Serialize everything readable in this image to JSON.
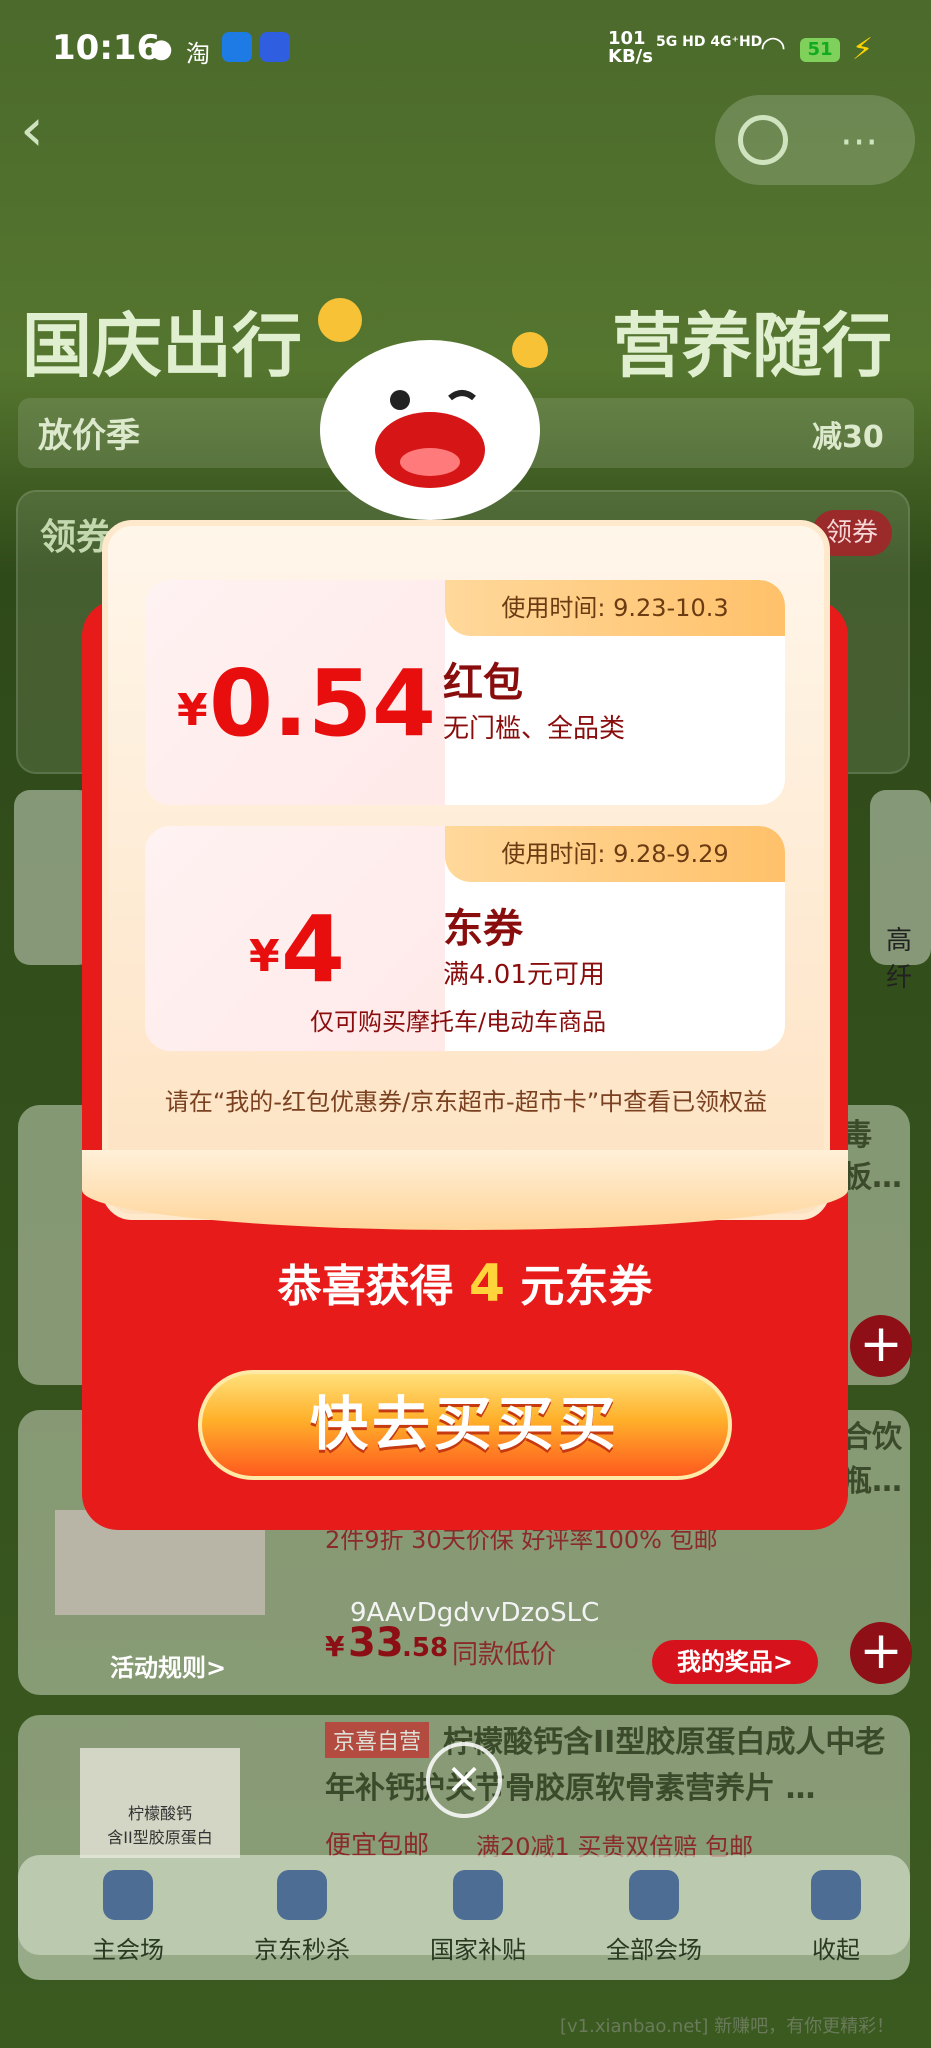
{
  "status": {
    "time": "10:16",
    "speed": "101\nKB/s",
    "network": "5G HD 4G⁺HD",
    "battery": "51"
  },
  "hero": {
    "title_left": "国庆出行",
    "title_right": "营养随行",
    "promo_label": "放价季",
    "promo_right": "减30",
    "coupon_panel_title": "领券",
    "coupon_panel_btn": "领券"
  },
  "background_products": [
    {
      "title": "毒",
      "subtitle": "板…"
    },
    {
      "title": "合饮",
      "subtitle": "瓶…",
      "tags": "2件9折  30天价保  好评率100%  包邮",
      "price_symbol": "¥",
      "price_int": "33",
      "price_dec": ".58",
      "price_note": "同款低价"
    },
    {
      "tag": "京喜自营",
      "title": "柠檬酸钙含II型胶原蛋白成人中老年补钙护关节骨胶原软骨素营养片 …",
      "promo1": "便宜包邮",
      "promo2": "满20减1  买贵双倍赔  包邮",
      "image_text": "柠檬酸钙\n含II型胶原蛋白"
    }
  ],
  "side_text_right": "高纤",
  "modal": {
    "coupons": [
      {
        "time": "使用时间: 9.23-10.3",
        "currency": "¥",
        "amount": "0.54",
        "title": "红包",
        "desc": "无门槛、全品类",
        "note": ""
      },
      {
        "time": "使用时间: 9.28-9.29",
        "currency": "¥",
        "amount": "4",
        "title": "东券",
        "desc": "满4.01元可用",
        "note": "仅可购买摩托车/电动车商品"
      }
    ],
    "hint": "请在“我的-红包优惠券/京东超市-超市卡”中查看已领权益",
    "congrats_prefix": "恭喜获得",
    "congrats_num": "4",
    "congrats_suffix": "元东券",
    "cta": "快去买买买",
    "code": "9AAvDgdvvDzoSLC",
    "rules": "活动规则>",
    "prizes": "我的奖品>"
  },
  "bottom_nav": [
    {
      "label": "主会场",
      "icon": "home-icon"
    },
    {
      "label": "京东秒杀",
      "icon": "alarm-clock-icon"
    },
    {
      "label": "国家补贴",
      "icon": "money-bag-icon"
    },
    {
      "label": "全部会场",
      "icon": "grid-icon"
    },
    {
      "label": "收起",
      "icon": "collapse-arrow-icon"
    }
  ],
  "watermark": "[v1.xianbao.net] 新赚吧，有你更精彩！"
}
